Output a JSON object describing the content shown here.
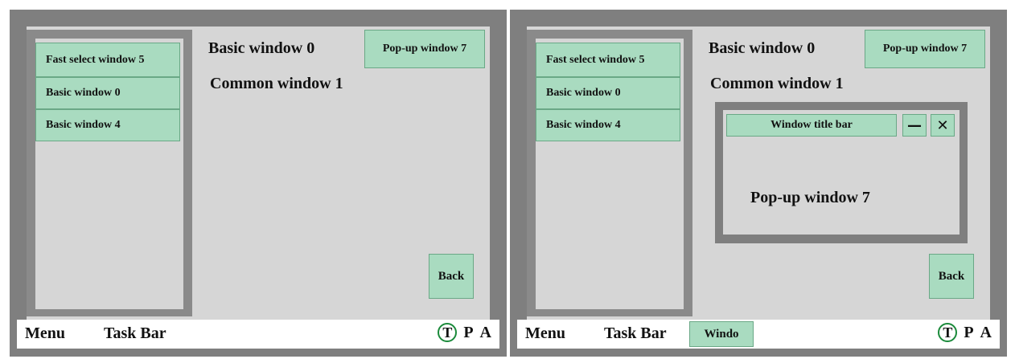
{
  "left_screen": {
    "fast_select_items": [
      {
        "label": "Fast select window 5"
      },
      {
        "label": "Basic window 0"
      },
      {
        "label": "Basic window 4"
      }
    ],
    "basic_title": "Basic window 0",
    "common_title": "Common window 1",
    "popup_button": "Pop-up window 7",
    "back_button": "Back",
    "taskbar": {
      "menu": "Menu",
      "task_bar": "Task Bar",
      "t": "T",
      "p": "P",
      "a": "A"
    }
  },
  "right_screen": {
    "fast_select_items": [
      {
        "label": "Fast select window 5"
      },
      {
        "label": "Basic window 0"
      },
      {
        "label": "Basic window 4"
      }
    ],
    "basic_title": "Basic window 0",
    "common_title": "Common window 1",
    "popup_button": "Pop-up window 7",
    "popup": {
      "title_bar": "Window title bar",
      "minimize": "—",
      "close": "✕",
      "label": "Pop-up window 7"
    },
    "back_button": "Back",
    "taskbar": {
      "menu": "Menu",
      "task_bar": "Task Bar",
      "window_button": "Windo",
      "t": "T",
      "p": "P",
      "a": "A"
    }
  },
  "colors": {
    "frame": "#7f7f7f",
    "panel": "#d6d6d6",
    "button": "#a9dbc0",
    "taskbar": "#ffffff"
  }
}
